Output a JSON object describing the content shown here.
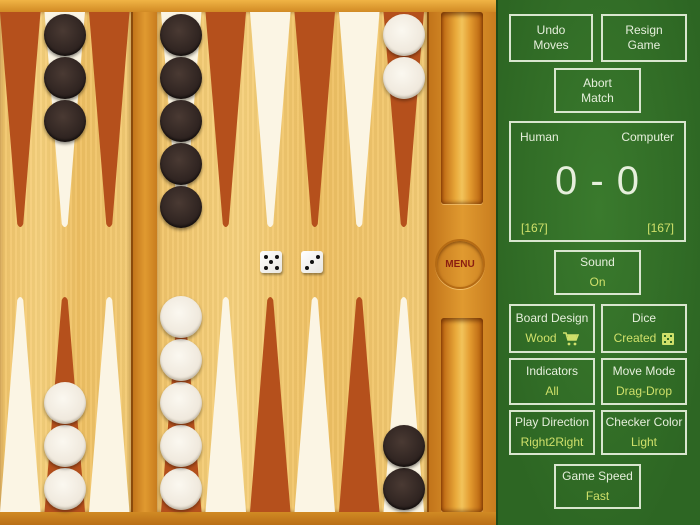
{
  "board": {
    "colors": {
      "dark_point": "#b5501c",
      "light_point": "#fbf5e4",
      "dark_checker": "#2e2320",
      "light_checker": "#efe8dc",
      "wood": "#f1c46a"
    },
    "left_section": {
      "top_points": [
        {
          "color": "dark",
          "checkers": 0,
          "checker_color": null
        },
        {
          "color": "light",
          "checkers": 3,
          "checker_color": "dark"
        },
        {
          "color": "dark",
          "checkers": 0,
          "checker_color": null
        }
      ],
      "bottom_points": [
        {
          "color": "light",
          "checkers": 0,
          "checker_color": null
        },
        {
          "color": "dark",
          "checkers": 3,
          "checker_color": "light"
        },
        {
          "color": "light",
          "checkers": 0,
          "checker_color": null
        }
      ]
    },
    "right_section": {
      "top_points": [
        {
          "color": "light",
          "checkers": 5,
          "checker_color": "dark"
        },
        {
          "color": "dark",
          "checkers": 0,
          "checker_color": null
        },
        {
          "color": "light",
          "checkers": 0,
          "checker_color": null
        },
        {
          "color": "dark",
          "checkers": 0,
          "checker_color": null
        },
        {
          "color": "light",
          "checkers": 0,
          "checker_color": null
        },
        {
          "color": "dark",
          "checkers": 2,
          "checker_color": "light"
        }
      ],
      "bottom_points": [
        {
          "color": "dark",
          "checkers": 5,
          "checker_color": "light"
        },
        {
          "color": "light",
          "checkers": 0,
          "checker_color": null
        },
        {
          "color": "dark",
          "checkers": 0,
          "checker_color": null
        },
        {
          "color": "light",
          "checkers": 0,
          "checker_color": null
        },
        {
          "color": "dark",
          "checkers": 0,
          "checker_color": null
        },
        {
          "color": "light",
          "checkers": 2,
          "checker_color": "dark"
        }
      ]
    },
    "dice": [
      5,
      3
    ],
    "menu_label": "MENU"
  },
  "panel": {
    "undo": {
      "line1": "Undo",
      "line2": "Moves"
    },
    "resign": {
      "line1": "Resign",
      "line2": "Game"
    },
    "abort": {
      "line1": "Abort",
      "line2": "Match"
    },
    "score": {
      "player1": "Human",
      "player2": "Computer",
      "display": "0 - 0",
      "pip1": "[167]",
      "pip2": "[167]"
    },
    "sound": {
      "label": "Sound",
      "value": "On"
    },
    "board_design": {
      "label": "Board Design",
      "value": "Wood",
      "icon": "cart-icon"
    },
    "dice": {
      "label": "Dice",
      "value": "Created",
      "icon": "dice-icon"
    },
    "indicators": {
      "label": "Indicators",
      "value": "All"
    },
    "move_mode": {
      "label": "Move Mode",
      "value": "Drag-Drop"
    },
    "play_direction": {
      "label": "Play Direction",
      "value": "Right2Right"
    },
    "checker_color": {
      "label": "Checker Color",
      "value": "Light"
    },
    "game_speed": {
      "label": "Game Speed",
      "value": "Fast"
    },
    "colors": {
      "border": "#d9e6cf",
      "text": "#e6efdc",
      "value": "#cfe06a",
      "background": "#2f6b25"
    }
  }
}
